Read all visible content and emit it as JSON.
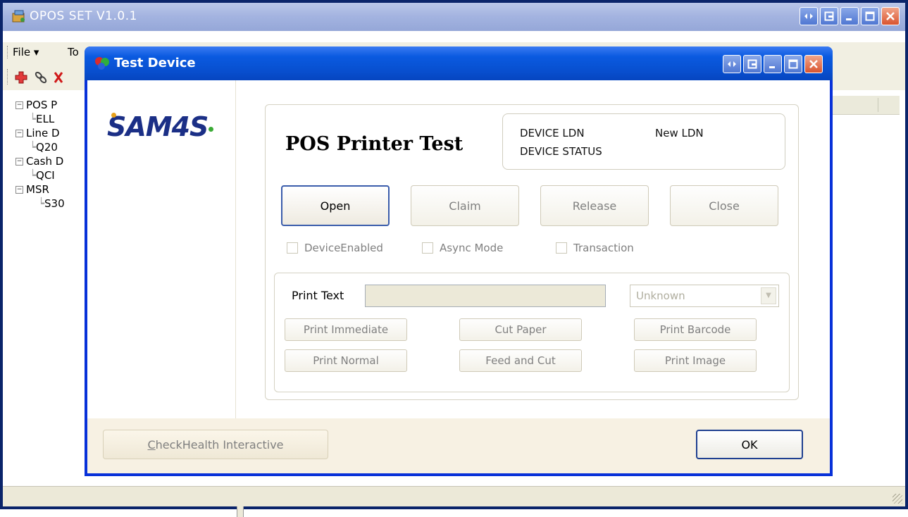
{
  "main_window": {
    "title": "OPOS SET V1.0.1",
    "menu": [
      "File ▾",
      "To"
    ],
    "toolbar_icons": [
      "add-icon",
      "link-icon",
      "delete-icon"
    ],
    "tree": [
      {
        "label": "POS P",
        "expander": "−"
      },
      {
        "label": "ELL"
      },
      {
        "label": "Line D",
        "expander": "−"
      },
      {
        "label": "Q20"
      },
      {
        "label": "Cash D",
        "expander": "−"
      },
      {
        "label": "QCI"
      },
      {
        "label": "MSR",
        "expander": "−"
      },
      {
        "label": "S30"
      }
    ]
  },
  "dialog": {
    "title": "Test Device",
    "logo": {
      "text": "SAM4S",
      "dot_colors": [
        "#e8a11a",
        "#3aaa35"
      ]
    },
    "panel_title": "POS Printer Test",
    "status": {
      "ldn_label": "DEVICE LDN",
      "ldn_value": "New LDN",
      "status_label": "DEVICE STATUS",
      "status_value": ""
    },
    "buttons": {
      "open": "Open",
      "claim": "Claim",
      "release": "Release",
      "close": "Close"
    },
    "checkboxes": {
      "device_enabled": "DeviceEnabled",
      "async_mode": "Async Mode",
      "transaction": "Transaction"
    },
    "print": {
      "label": "Print Text",
      "text_value": "",
      "combo_value": "Unknown",
      "buttons": {
        "print_immediate": "Print Immediate",
        "cut_paper": "Cut Paper",
        "print_barcode": "Print Barcode",
        "print_normal": "Print Normal",
        "feed_and_cut": "Feed and Cut",
        "print_image": "Print Image"
      }
    },
    "footer": {
      "checkhealth": "CheckHealth Interactive",
      "ok": "OK"
    }
  },
  "colors": {
    "xp_blue": "#0831d9",
    "logo_blue": "#1b2f86"
  }
}
